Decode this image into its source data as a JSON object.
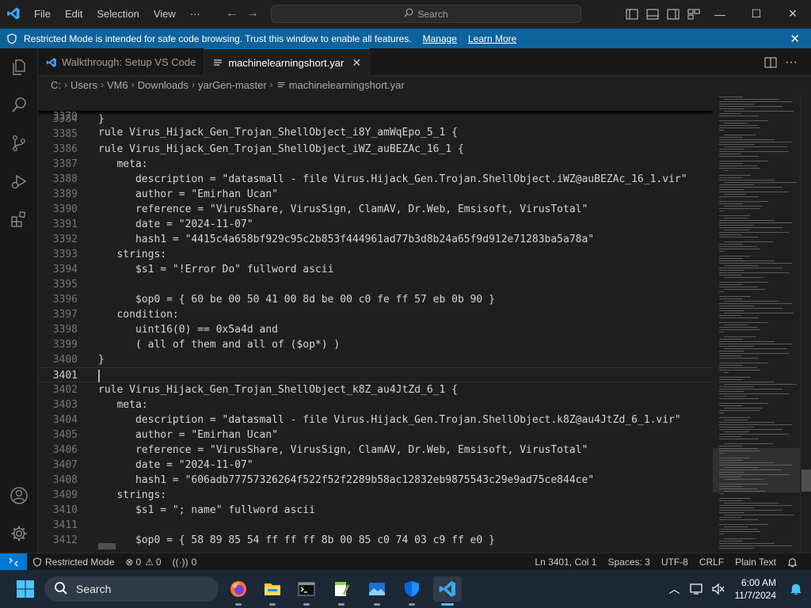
{
  "titlebar": {
    "menu": [
      "File",
      "Edit",
      "Selection",
      "View",
      "···"
    ],
    "search_placeholder": "Search"
  },
  "banner": {
    "text": "Restricted Mode is intended for safe code browsing. Trust this window to enable all features.",
    "manage": "Manage",
    "learn_more": "Learn More"
  },
  "tabs": [
    {
      "label": "Walkthrough: Setup VS Code",
      "active": false
    },
    {
      "label": "machinelearningshort.yar",
      "active": true
    }
  ],
  "breadcrumb": [
    "C:",
    "Users",
    "VM6",
    "Downloads",
    "yarGen-master",
    "machinelearningshort.yar"
  ],
  "sticky": {
    "num": "3370",
    "code": "rule Virus_Hijack_Gen_Trojan_ShellObject_i8Y_amWqEpo_5_1 {"
  },
  "lines": [
    {
      "num": "3384",
      "code": "}"
    },
    {
      "num": "3385",
      "code": ""
    },
    {
      "num": "3386",
      "code": "rule Virus_Hijack_Gen_Trojan_ShellObject_iWZ_auBEZAc_16_1 {"
    },
    {
      "num": "3387",
      "code": "   meta:"
    },
    {
      "num": "3388",
      "code": "      description = \"datasmall - file Virus.Hijack_Gen.Trojan.ShellObject.iWZ@auBEZAc_16_1.vir\""
    },
    {
      "num": "3389",
      "code": "      author = \"Emirhan Ucan\""
    },
    {
      "num": "3390",
      "code": "      reference = \"VirusShare, VirusSign, ClamAV, Dr.Web, Emsisoft, VirusTotal\""
    },
    {
      "num": "3391",
      "code": "      date = \"2024-11-07\""
    },
    {
      "num": "3392",
      "code": "      hash1 = \"4415c4a658bf929c95c2b853f444961ad77b3d8b24a65f9d912e71283ba5a78a\""
    },
    {
      "num": "3393",
      "code": "   strings:"
    },
    {
      "num": "3394",
      "code": "      $s1 = \"!Error Do\" fullword ascii"
    },
    {
      "num": "3395",
      "code": ""
    },
    {
      "num": "3396",
      "code": "      $op0 = { 60 be 00 50 41 00 8d be 00 c0 fe ff 57 eb 0b 90 }"
    },
    {
      "num": "3397",
      "code": "   condition:"
    },
    {
      "num": "3398",
      "code": "      uint16(0) == 0x5a4d and"
    },
    {
      "num": "3399",
      "code": "      ( all of them and all of ($op*) )"
    },
    {
      "num": "3400",
      "code": "}"
    },
    {
      "num": "3401",
      "code": "",
      "current": true
    },
    {
      "num": "3402",
      "code": "rule Virus_Hijack_Gen_Trojan_ShellObject_k8Z_au4JtZd_6_1 {"
    },
    {
      "num": "3403",
      "code": "   meta:"
    },
    {
      "num": "3404",
      "code": "      description = \"datasmall - file Virus.Hijack_Gen.Trojan.ShellObject.k8Z@au4JtZd_6_1.vir\""
    },
    {
      "num": "3405",
      "code": "      author = \"Emirhan Ucan\""
    },
    {
      "num": "3406",
      "code": "      reference = \"VirusShare, VirusSign, ClamAV, Dr.Web, Emsisoft, VirusTotal\""
    },
    {
      "num": "3407",
      "code": "      date = \"2024-11-07\""
    },
    {
      "num": "3408",
      "code": "      hash1 = \"606adb77757326264f522f52f2289b58ac12832eb9875543c29e9ad75ce844ce\""
    },
    {
      "num": "3409",
      "code": "   strings:"
    },
    {
      "num": "3410",
      "code": "      $s1 = \"; name\" fullword ascii"
    },
    {
      "num": "3411",
      "code": ""
    },
    {
      "num": "3412",
      "code": "      $op0 = { 58 89 85 54 ff ff ff 8b 00 85 c0 74 03 c9 ff e0 }"
    }
  ],
  "statusbar": {
    "restricted": "Restricted Mode",
    "errors": "0",
    "warnings": "0",
    "ports": "0",
    "position": "Ln 3401, Col 1",
    "spaces": "Spaces: 3",
    "encoding": "UTF-8",
    "eol": "CRLF",
    "language": "Plain Text"
  },
  "taskbar": {
    "search": "Search",
    "time": "6:00 AM",
    "date": "11/7/2024"
  },
  "colors": {
    "accent": "#0078d4",
    "banner": "#0e639c"
  }
}
